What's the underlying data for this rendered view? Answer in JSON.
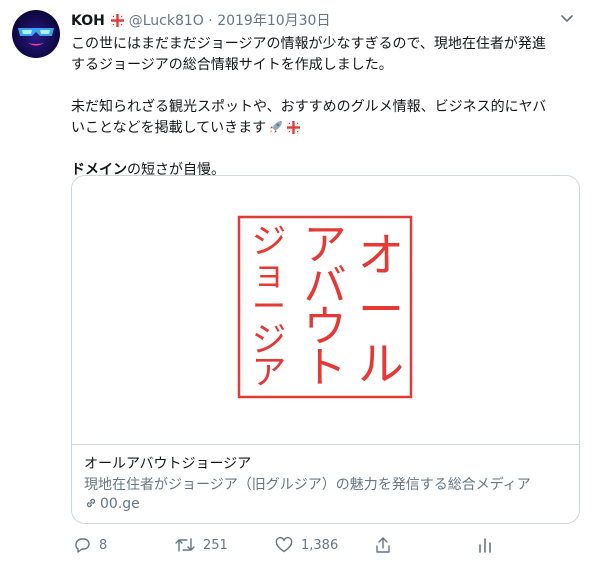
{
  "tweet": {
    "author_name": "KOH",
    "handle": "@Luck81O",
    "separator": "·",
    "date": "2019年10月30日",
    "line1": "この世にはまだまだジョージアの情報が少なすぎるので、現地在住者が発進",
    "line2": "するジョージアの総合情報サイトを作成しました。",
    "line3": "未だ知られざる観光スポットや、おすすめのグルメ情報、ビジネス的にヤバ",
    "line4": "いことなどを掲載していきます",
    "line5_bold": "ドメイン",
    "line5_rest": "の短さが自慢。"
  },
  "card": {
    "seal_columns": [
      "オール",
      "アバウト",
      "ジョージア"
    ],
    "title": "オールアバウトジョージア",
    "description": "現地在住者がジョージア（旧グルジア）の魅力を発信する総合メディア",
    "link": "00.ge"
  },
  "actions": {
    "replies": "8",
    "retweets": "251",
    "likes": "1,386"
  },
  "colors": {
    "seal_red": "#e53935",
    "muted": "#657786",
    "border": "#ccd6dd"
  },
  "icons": [
    "reply-icon",
    "retweet-icon",
    "like-icon",
    "share-icon",
    "analytics-icon",
    "link-icon",
    "caret-down-icon",
    "georgia-flag-icon",
    "rocket-icon"
  ]
}
